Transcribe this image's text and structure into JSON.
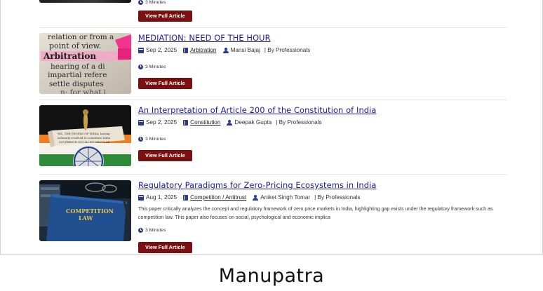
{
  "partial": {
    "read_time": "3 Minutes",
    "button_label": "View Full Article"
  },
  "articles": [
    {
      "title": "MEDIATION: NEED OF THE HOUR",
      "date": "Sep 2, 2025",
      "category": "Arbitration",
      "author": "Mansi Bajaj",
      "byline": "| By Professionals",
      "description": "",
      "read_time": "3 Minutes",
      "button_label": "View Full Article",
      "thumb_icon": "arbitration-dictionary-image"
    },
    {
      "title": "An Interpretation of Article 200 of the Constitution of India",
      "date": "Sep 2, 2025",
      "category": "Constitution",
      "author": "Deepak Gupta",
      "byline": "| By Professionals",
      "description": "",
      "read_time": "3 Minutes",
      "button_label": "View Full Article",
      "thumb_icon": "constitution-scroll-flag-image"
    },
    {
      "title": "Regulatory Paradigms for Zero-Pricing Ecosystems in India",
      "date": "Aug 1, 2025",
      "category": "Competition / Antitrust",
      "author": "Aniket Singh Tomar",
      "byline": "| By Professionals",
      "description": "This paper critically analyzes the concept and regulatory framework of zero price markets in India, highlighting gap exists under the regulatory framework such as competition law. This paper also focuses on social, psychological and economic implica",
      "read_time": "3 Minutes",
      "button_label": "View Full Article",
      "thumb_icon": "competition-law-book-image"
    }
  ],
  "thumb_text": {
    "arbitration": [
      "relation or from a",
      "point of view.",
      "Arbitration",
      "hearing of a di",
      "impartial refere",
      "settle disputes",
      "n; for what i"
    ],
    "constitution": [
      "WE, THE PEOPLE OF INDIA, having",
      "solemnly resolved to constitute India",
      "SOVEREIGN SOCIALIST SECULAR"
    ],
    "competition": [
      "COMPETITION",
      "LAW"
    ]
  },
  "footer": {
    "brand": "Manupatra"
  },
  "colors": {
    "accent_button": "#7a1010",
    "title_link": "#1a1aa6",
    "icon": "#2a3b8f"
  }
}
